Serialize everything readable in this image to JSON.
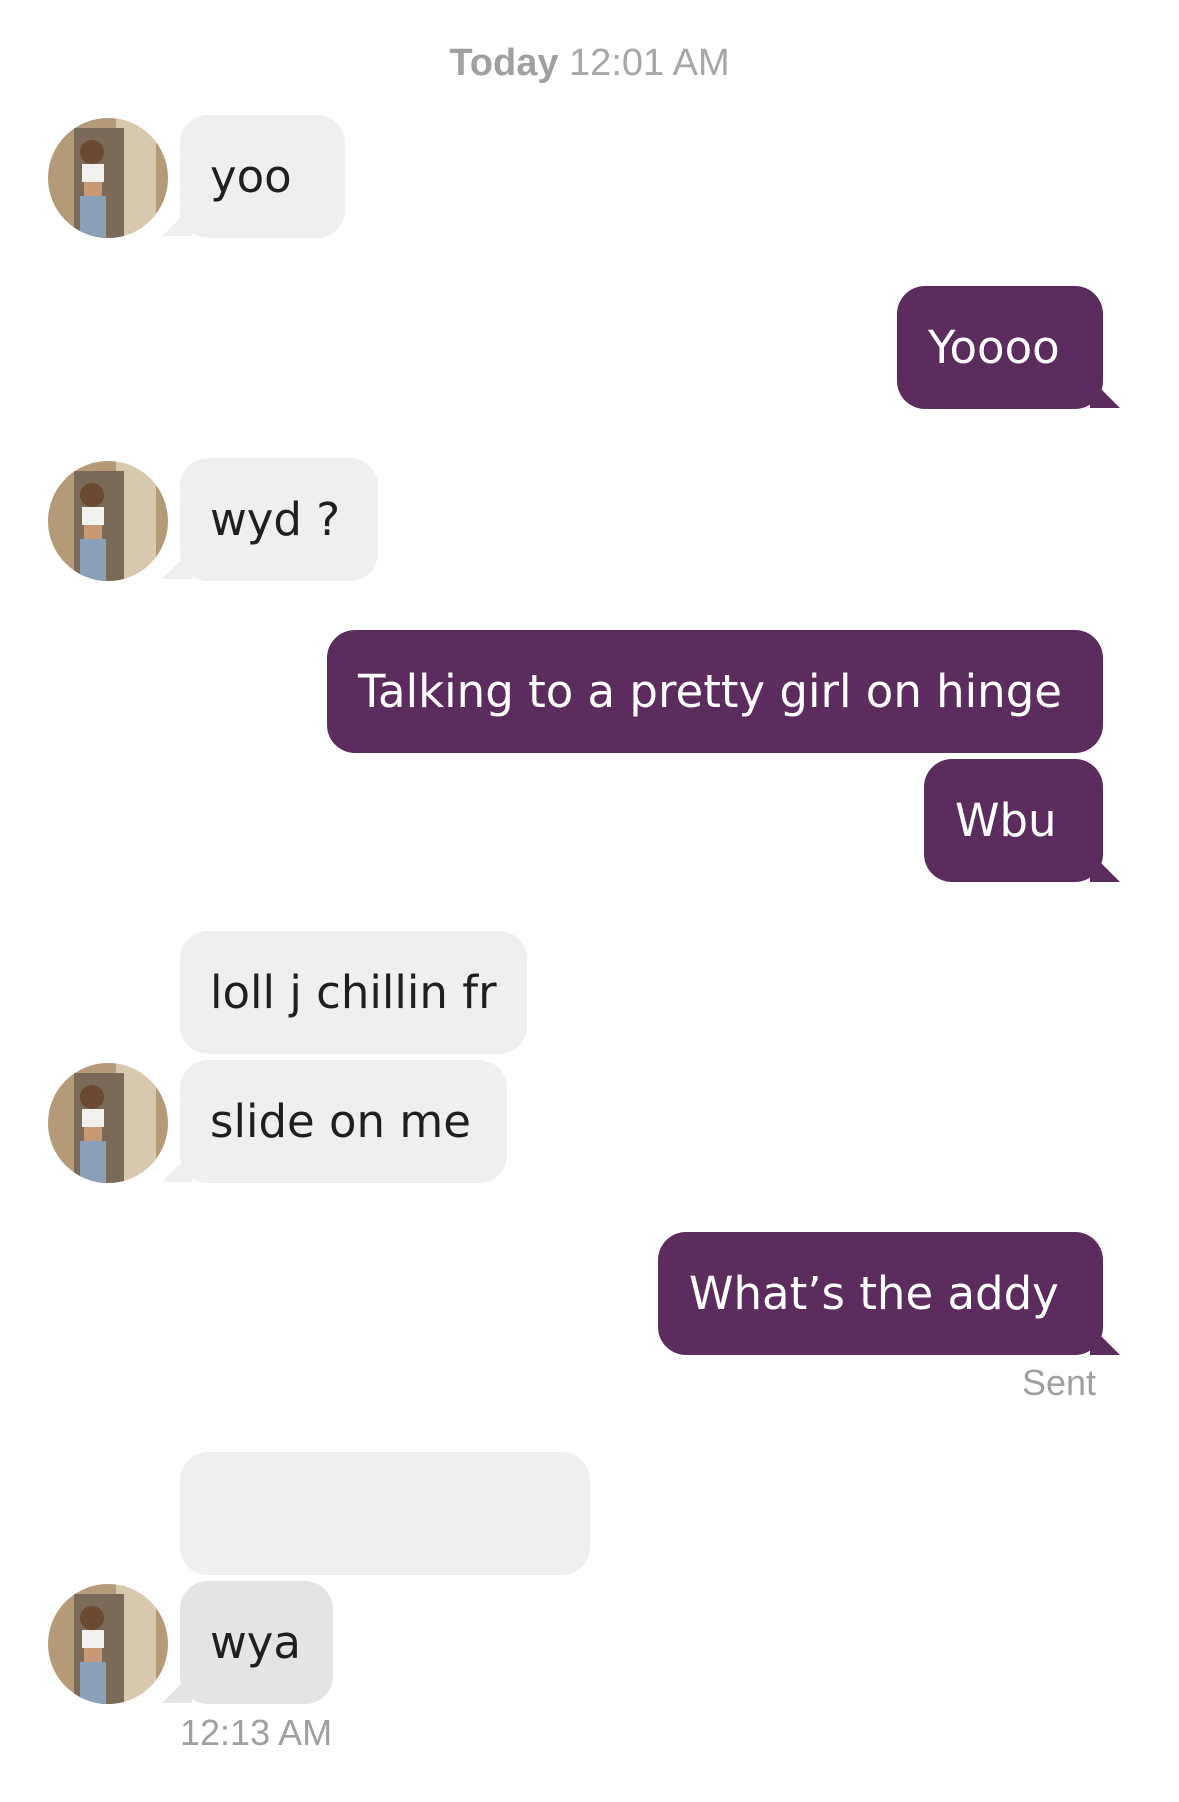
{
  "header": {
    "day": "Today",
    "time": "12:01 AM"
  },
  "messages": [
    {
      "from": "them",
      "text": "yoo"
    },
    {
      "from": "me",
      "text": "Yoooo"
    },
    {
      "from": "them",
      "text": "wyd ?"
    },
    {
      "from": "me",
      "text": "Talking to a pretty girl on hinge"
    },
    {
      "from": "me",
      "text": "Wbu"
    },
    {
      "from": "them",
      "text": "loll j chillin fr"
    },
    {
      "from": "them",
      "text": "slide on me"
    },
    {
      "from": "me",
      "text": "What’s the addy"
    },
    {
      "from": "them",
      "text": "wya"
    }
  ],
  "status": {
    "sent_label": "Sent",
    "last_time": "12:13 AM"
  },
  "colors": {
    "outgoing_bubble": "#5d2c5e",
    "incoming_bubble": "#efefef",
    "meta_text": "#9f9f9f"
  },
  "icons": {
    "avatar": "contact-photo"
  }
}
